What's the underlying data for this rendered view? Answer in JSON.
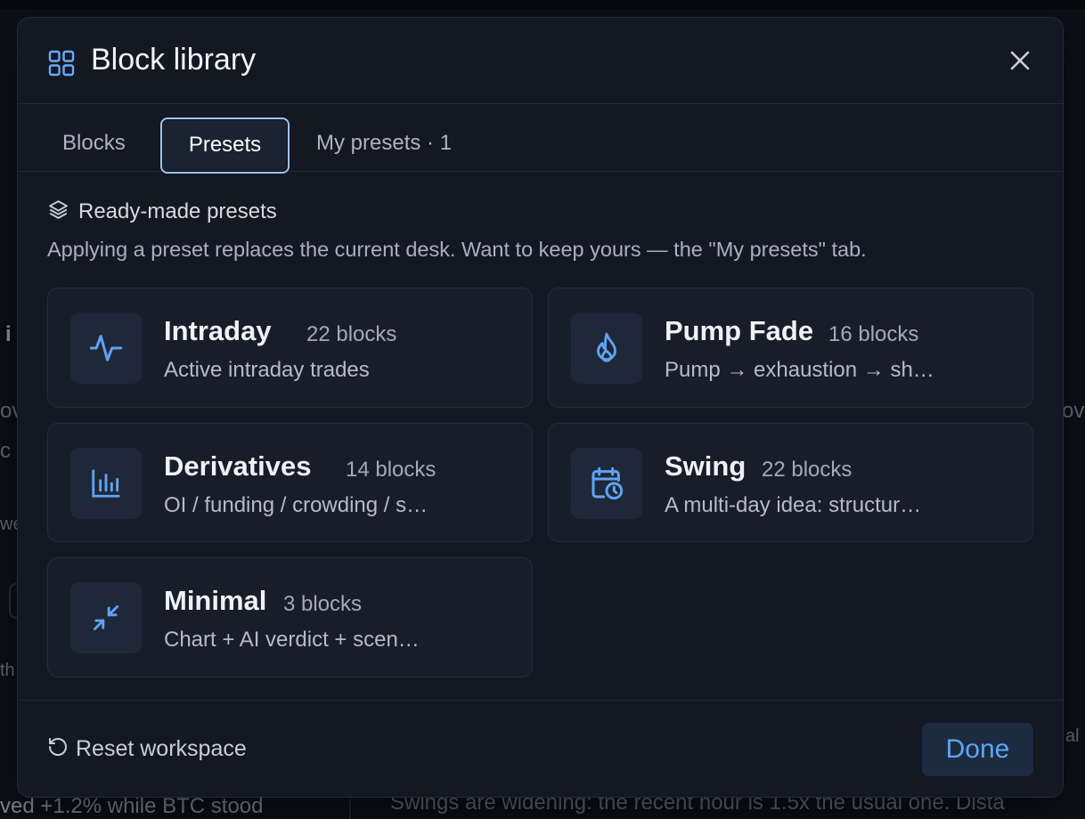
{
  "background": {
    "bottom_left_text": "ved +1.2% while BTC stood",
    "bottom_right_text": "Swings are widening: the recent hour is 1.5x the usual one. Dista"
  },
  "modal": {
    "title": "Block library",
    "header_icon": "grid-icon",
    "close_icon": "close-icon"
  },
  "tabs": [
    {
      "label": "Blocks",
      "active": false
    },
    {
      "label": "Presets",
      "active": true
    },
    {
      "label": "My presets · 1",
      "active": false
    }
  ],
  "section": {
    "icon": "layers-icon",
    "title": "Ready-made presets",
    "description": "Applying a preset replaces the current desk. Want to keep yours — the \"My presets\" tab."
  },
  "presets": [
    {
      "name": "Intraday",
      "count": "22 blocks",
      "description": "Active intraday trades",
      "icon": "activity-icon"
    },
    {
      "name": "Pump Fade",
      "count": "16 blocks",
      "description": "Pump → exhaustion → sh…",
      "icon": "flame-icon"
    },
    {
      "name": "Derivatives",
      "count": "14 blocks",
      "description": "OI / funding / crowding / s…",
      "icon": "bar-chart-icon"
    },
    {
      "name": "Swing",
      "count": "22 blocks",
      "description": "A multi-day idea: structur…",
      "icon": "calendar-clock-icon"
    },
    {
      "name": "Minimal",
      "count": "3 blocks",
      "description": "Chart + AI verdict + scen…",
      "icon": "minimize-icon"
    }
  ],
  "footer": {
    "reset_label": "Reset workspace",
    "reset_icon": "rotate-ccw-icon",
    "done_label": "Done"
  },
  "colors": {
    "accent": "#5ea4f4",
    "modal_bg": "#131823",
    "card_bg": "#171d29",
    "active_tab_border": "#9cc4f5"
  }
}
